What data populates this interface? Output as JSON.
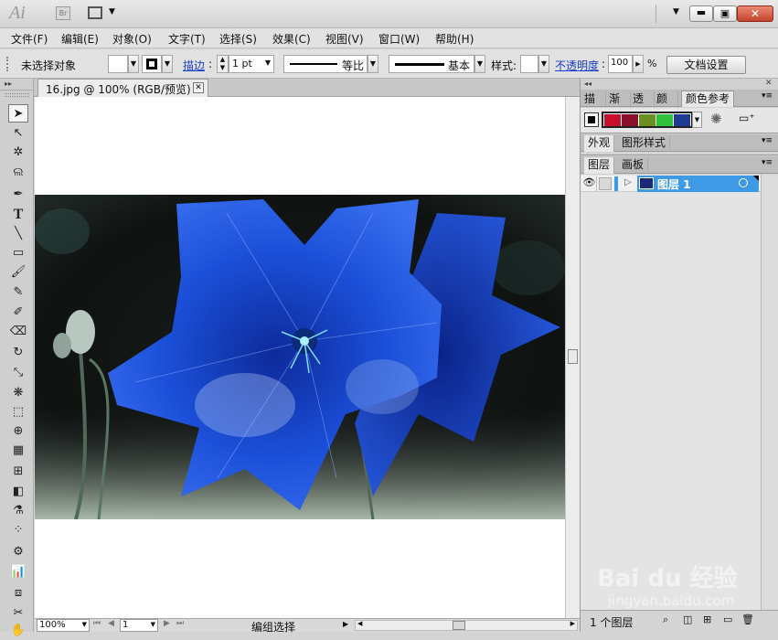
{
  "titlebar": {
    "app_logo": "Ai",
    "bridge_label": "Br"
  },
  "menu": [
    "文件(F)",
    "编辑(E)",
    "对象(O)",
    "文字(T)",
    "选择(S)",
    "效果(C)",
    "视图(V)",
    "窗口(W)",
    "帮助(H)"
  ],
  "control": {
    "selection_status": "未选择对象",
    "stroke_link": "描边",
    "stroke_weight": "1 pt",
    "profile_label": "等比",
    "brush_label": "基本",
    "style_label": "样式:",
    "opacity_link": "不透明度",
    "opacity_value": "100",
    "opacity_unit": "%",
    "doc_setup_button": "文档设置"
  },
  "document": {
    "tab_title": "16.jpg @ 100% (RGB/预览)"
  },
  "status": {
    "zoom": "100%",
    "page": "1",
    "mode_label": "编组选择"
  },
  "panels": {
    "top_tabs": [
      "描边",
      "渐变",
      "透明",
      "颜色",
      "颜色参考"
    ],
    "appearance_tab": "外观",
    "graphic_styles_tab": "图形样式",
    "layers_tab": "图层",
    "artboards_tab": "画板",
    "layer_name": "图层 1",
    "layer_count": "1 个图层"
  },
  "colors": {
    "harmony": [
      "#c8102e",
      "#8b0f2a",
      "#6b8e23",
      "#2fbf3a",
      "#1f3a93"
    ],
    "layer_highlight": "#3f9ae6"
  },
  "watermark": {
    "brand": "Bai du 经验",
    "url": "jingyan.baidu.com"
  }
}
